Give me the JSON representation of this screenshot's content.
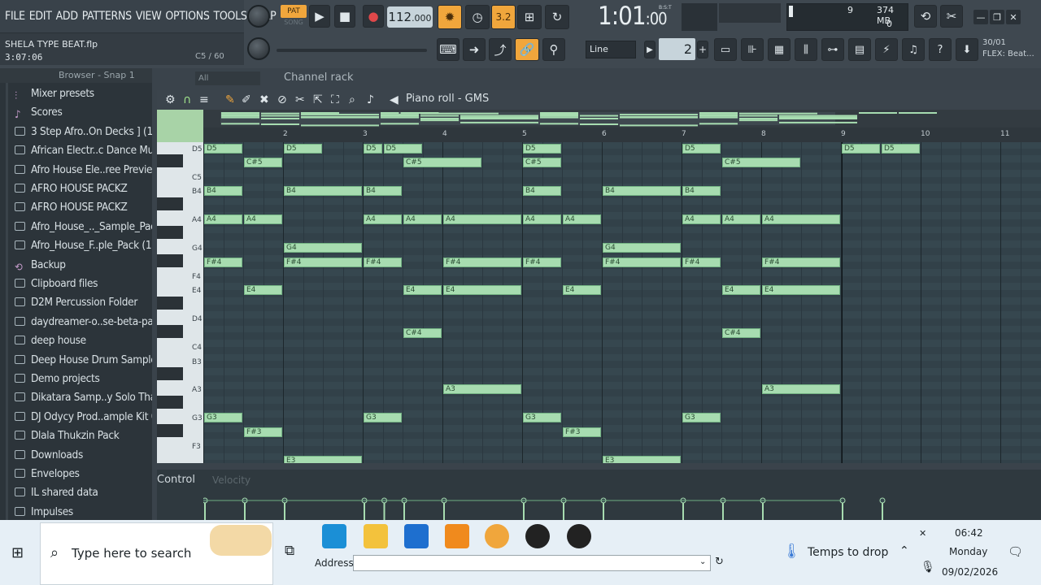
{
  "menu": [
    "FILE",
    "EDIT",
    "ADD",
    "PATTERNS",
    "VIEW",
    "OPTIONS",
    "TOOLS",
    "HELP"
  ],
  "song": {
    "file": "SHELA TYPE BEAT.flp",
    "time": "3:07:06",
    "note": "C5 / 60"
  },
  "transport": {
    "pat": "PAT",
    "song": "SONG",
    "tempo": "112",
    "tempo_dec": ".000",
    "display": "1:01",
    "display_small": ":00",
    "bst": "B:S:T",
    "step": "3.2"
  },
  "sysmon": {
    "cpu": "9",
    "mem": "374 MB",
    "poly": "0"
  },
  "snap": {
    "mode": "Line",
    "value": "2"
  },
  "flex": {
    "line1": "30/01",
    "line2": "FLEX: Beat..."
  },
  "browser": {
    "header": "Browser - Snap 1",
    "filter": "All",
    "items": [
      {
        "label": "Mixer presets",
        "icon": "mixer-icon"
      },
      {
        "label": "Scores",
        "icon": "note-icon"
      },
      {
        "label": "3 Step Afro..On Decks ] (1)",
        "icon": "folder-icon"
      },
      {
        "label": "African Electr..c Dance Music",
        "icon": "folder-icon"
      },
      {
        "label": "Afro House Ele..ree Preview)",
        "icon": "folder-icon"
      },
      {
        "label": "AFRO HOUSE PACKZ",
        "icon": "folder-icon"
      },
      {
        "label": "AFRO HOUSE PACKZ",
        "icon": "folder-icon"
      },
      {
        "label": "Afro_House_.._Sample_Pack",
        "icon": "folder-icon"
      },
      {
        "label": "Afro_House_F..ple_Pack (1)",
        "icon": "folder-icon"
      },
      {
        "label": "Backup",
        "icon": "backup-icon"
      },
      {
        "label": "Clipboard files",
        "icon": "folder-icon"
      },
      {
        "label": "D2M Percussion Folder",
        "icon": "folder-icon"
      },
      {
        "label": "daydreamer-o..se-beta-pack",
        "icon": "folder-icon"
      },
      {
        "label": "deep house",
        "icon": "folder-icon"
      },
      {
        "label": "Deep House Drum Samples",
        "icon": "folder-icon"
      },
      {
        "label": "Demo projects",
        "icon": "folder-icon"
      },
      {
        "label": "Dikatara Samp..y Solo Thato",
        "icon": "folder-icon"
      },
      {
        "label": "DJ Odycy Prod..ample Kit 01",
        "icon": "folder-icon"
      },
      {
        "label": "Dlala Thukzin Pack",
        "icon": "folder-icon"
      },
      {
        "label": "Downloads",
        "icon": "folder-icon"
      },
      {
        "label": "Envelopes",
        "icon": "folder-icon"
      },
      {
        "label": "IL shared data",
        "icon": "folder-icon"
      },
      {
        "label": "Impulses",
        "icon": "folder-icon"
      }
    ]
  },
  "channel_rack": "Channel rack",
  "piano_roll": {
    "title": "Piano roll - GMS",
    "bars": [
      "2",
      "3",
      "4",
      "5",
      "6",
      "7",
      "8",
      "9",
      "10",
      "11"
    ],
    "keys": [
      "D5",
      "C5",
      "B4",
      "A4",
      "G4",
      "F4",
      "E4",
      "D4",
      "C4",
      "B3",
      "A3",
      "G3",
      "F3"
    ],
    "notes": [
      [
        "D5",
        1,
        1,
        2
      ],
      [
        "D5",
        3,
        1,
        2
      ],
      [
        "D5",
        5,
        0.5,
        2
      ],
      [
        "D5",
        5.5,
        1,
        2
      ],
      [
        "D5",
        9,
        1,
        2
      ],
      [
        "D5",
        13,
        1,
        2
      ],
      [
        "D5",
        17,
        1,
        2
      ],
      [
        "D5",
        18,
        1,
        2
      ],
      [
        "C#5",
        2,
        1,
        1
      ],
      [
        "C#5",
        6,
        2,
        1
      ],
      [
        "C#5",
        9,
        1,
        1
      ],
      [
        "C#5",
        14,
        2,
        1
      ],
      [
        "B4",
        1,
        1,
        0
      ],
      [
        "B4",
        3,
        2,
        0
      ],
      [
        "B4",
        5,
        1,
        0
      ],
      [
        "B4",
        9,
        1,
        0
      ],
      [
        "B4",
        11,
        2,
        0
      ],
      [
        "B4",
        13,
        1,
        0
      ],
      [
        "A4",
        1,
        1,
        0
      ],
      [
        "A4",
        2,
        1,
        0
      ],
      [
        "A4",
        5,
        1,
        0
      ],
      [
        "A4",
        6,
        1,
        0
      ],
      [
        "A4",
        7,
        2,
        0
      ],
      [
        "A4",
        9,
        1,
        0
      ],
      [
        "A4",
        10,
        1,
        0
      ],
      [
        "A4",
        13,
        1,
        0
      ],
      [
        "A4",
        14,
        1,
        0
      ],
      [
        "A4",
        15,
        2,
        0
      ],
      [
        "G4",
        3,
        2,
        0
      ],
      [
        "G4",
        11,
        2,
        0
      ],
      [
        "F#4",
        1,
        1,
        0
      ],
      [
        "F#4",
        3,
        2,
        0
      ],
      [
        "F#4",
        5,
        1,
        0
      ],
      [
        "F#4",
        7,
        2,
        0
      ],
      [
        "F#4",
        9,
        1,
        0
      ],
      [
        "F#4",
        11,
        2,
        0
      ],
      [
        "F#4",
        13,
        1,
        0
      ],
      [
        "F#4",
        15,
        2,
        0
      ],
      [
        "E4",
        2,
        1,
        0
      ],
      [
        "E4",
        6,
        1,
        0
      ],
      [
        "E4",
        7,
        2,
        0
      ],
      [
        "E4",
        10,
        1,
        0
      ],
      [
        "E4",
        14,
        1,
        0
      ],
      [
        "E4",
        15,
        2,
        0
      ],
      [
        "C#4",
        6,
        1,
        0
      ],
      [
        "C#4",
        14,
        1,
        0
      ],
      [
        "A3",
        7,
        2,
        0
      ],
      [
        "A3",
        15,
        2,
        0
      ],
      [
        "G3",
        1,
        1,
        0
      ],
      [
        "G3",
        5,
        1,
        0
      ],
      [
        "G3",
        9,
        1,
        0
      ],
      [
        "G3",
        13,
        1,
        0
      ],
      [
        "F#3",
        2,
        1,
        0
      ],
      [
        "F#3",
        10,
        1,
        0
      ],
      [
        "E3",
        3,
        2,
        0
      ],
      [
        "E3",
        11,
        2,
        0
      ]
    ]
  },
  "control": {
    "label": "Control",
    "target": "Velocity"
  },
  "taskbar": {
    "search_placeholder": "Type here to search",
    "address_label": "Address",
    "weather": "Temps to drop",
    "time": "06:42",
    "day": "Monday",
    "date": "09/02/2026"
  },
  "colors": {
    "accent": "#f0a63c",
    "note": "#a7dcb0",
    "grid": "#34454d"
  }
}
